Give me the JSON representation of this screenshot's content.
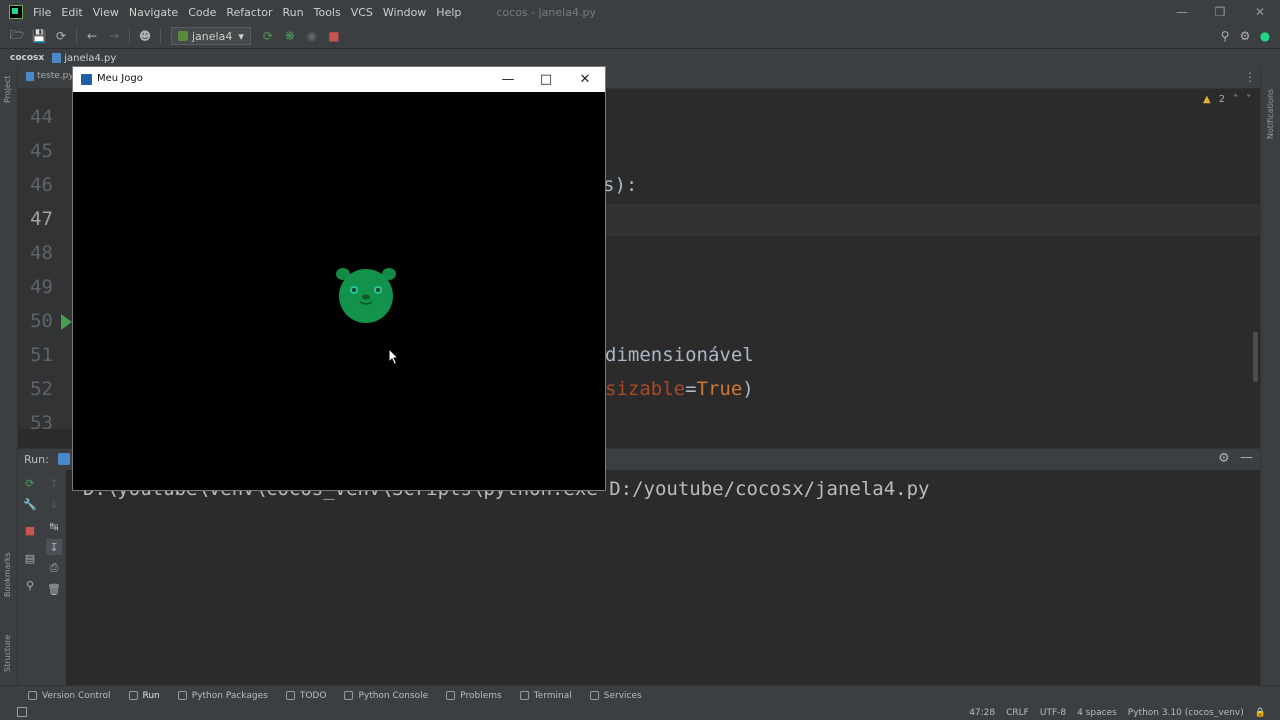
{
  "menu": {
    "items": [
      "File",
      "Edit",
      "View",
      "Navigate",
      "Code",
      "Refactor",
      "Run",
      "Tools",
      "VCS",
      "Window",
      "Help"
    ],
    "window_title": "cocos - janela4.py"
  },
  "toolbar": {
    "run_config": "janela4"
  },
  "breadcrumb": {
    "project": "cocosx",
    "file": "janela4.py"
  },
  "editor": {
    "tab_partial": "teste.py",
    "line_numbers": [
      "44",
      "45",
      "46",
      "47",
      "48",
      "49",
      "50",
      "51",
      "52",
      "53"
    ],
    "code_fragment_46": "s):",
    "code_fragment_51": "dimensionável",
    "code_fragment_52a": "sizable",
    "code_fragment_52b": "=",
    "code_fragment_52c": "True",
    "code_fragment_52d": ")",
    "warnings": "2"
  },
  "run_panel": {
    "label": "Run:",
    "console_line": "D:\\youtube\\venv\\cocos_venv\\Scripts\\python.exe D:/youtube/cocosx/janela4.py"
  },
  "side_labels": {
    "project": "Project",
    "bookmarks": "Bookmarks",
    "structure": "Structure",
    "notifications": "Notifications"
  },
  "bottom_tools": [
    "Version Control",
    "Run",
    "Python Packages",
    "TODO",
    "Python Console",
    "Problems",
    "Terminal",
    "Services"
  ],
  "status": {
    "position": "47:28",
    "line_ending": "CRLF",
    "encoding": "UTF-8",
    "indent": "4 spaces",
    "interpreter": "Python 3.10 (cocos_venv)"
  },
  "game_window": {
    "title": "Meu Jogo"
  }
}
